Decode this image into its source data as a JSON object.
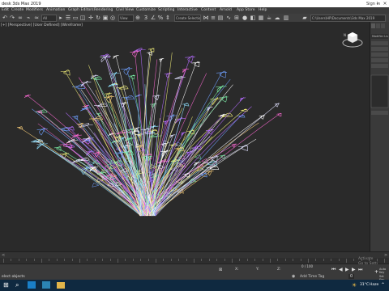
{
  "app": {
    "title": "desk 3ds Max 2019",
    "signin": "Sign In"
  },
  "menu": [
    "Edit",
    "Create",
    "Modifiers",
    "Animation",
    "Graph Editors",
    "Rendering",
    "Civil View",
    "Customize",
    "Scripting",
    "Interactive",
    "Content",
    "Arnold",
    "App Store",
    "Help"
  ],
  "toolbar": {
    "filter_dropdown": "All",
    "view_dropdown": "View",
    "selection_set_dropdown": "Create Selection Se",
    "workspace_path": "C:\\Users\\HP\\Documents\\3ds Max 2019"
  },
  "viewport": {
    "label": "[+] [Perspective] [User Defined] [Wireframe]"
  },
  "command_panel": {
    "tab_label": "Modifier List"
  },
  "timeline": {
    "frame_display": "0 / 100"
  },
  "status": {
    "selection": "elect objects",
    "add_time_tag": "Add Time Tag",
    "auto_key": "Auto Key",
    "set_key": "Set Key",
    "frame_counter": "0",
    "activate_1": "Activate",
    "activate_2": "Go to Setti"
  },
  "taskbar": {
    "weather": "31°C",
    "time": "Haze"
  },
  "colors": {
    "accent": "#1a7fc7",
    "background": "#2b2b2b"
  }
}
